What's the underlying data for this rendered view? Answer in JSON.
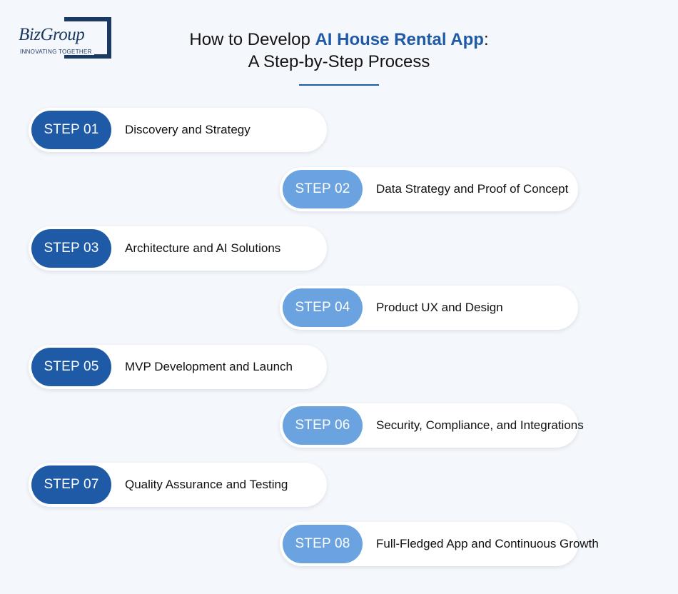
{
  "logo": {
    "wordmark": "BizGroup",
    "tagline": "INNOVATING TOGETHER"
  },
  "title": {
    "line1_prefix": "How to Develop ",
    "line1_accent": "AI House Rental App",
    "line1_suffix": ":",
    "line2": "A Step-by-Step Process"
  },
  "steps": [
    {
      "badge": "STEP 01",
      "label": "Discovery and Strategy"
    },
    {
      "badge": "STEP 02",
      "label": "Data Strategy and Proof of Concept"
    },
    {
      "badge": "STEP 03",
      "label": "Architecture and AI Solutions"
    },
    {
      "badge": "STEP 04",
      "label": "Product UX and Design"
    },
    {
      "badge": "STEP 05",
      "label": "MVP Development and Launch"
    },
    {
      "badge": "STEP 06",
      "label": "Security, Compliance, and Integrations"
    },
    {
      "badge": "STEP 07",
      "label": "Quality Assurance and Testing"
    },
    {
      "badge": "STEP 08",
      "label": "Full-Fledged App and Continuous Growth"
    }
  ],
  "colors": {
    "background": "#f4f7fb",
    "brand_dark_blue": "#1f5aa6",
    "light_blue": "#6aa3e0",
    "logo_navy": "#1b3a63"
  }
}
